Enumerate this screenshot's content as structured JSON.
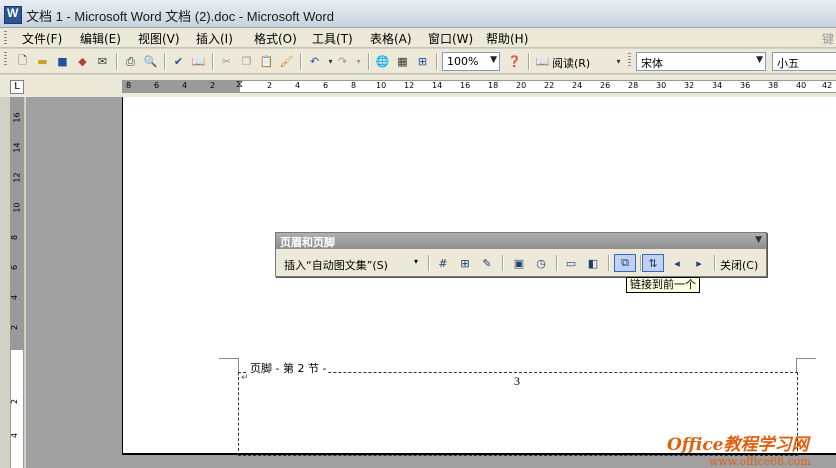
{
  "window": {
    "title": "文档 1 - Microsoft Word 文档 (2).doc - Microsoft Word"
  },
  "menu": {
    "items": [
      "文件(F)",
      "编辑(E)",
      "视图(V)",
      "插入(I)",
      "格式(O)",
      "工具(T)",
      "表格(A)",
      "窗口(W)",
      "帮助(H)"
    ],
    "right_cut": "键"
  },
  "toolbar": {
    "zoom": "100%",
    "read_label": "阅读(R)",
    "font_name": "宋体",
    "font_size": "小五",
    "icons": [
      "new-icon",
      "open-icon",
      "save-icon",
      "permission-icon",
      "email-icon",
      "print-icon",
      "print-preview-icon",
      "spelling-icon",
      "research-icon",
      "cut-icon",
      "copy-icon",
      "paste-icon",
      "format-painter-icon",
      "undo-icon",
      "redo-icon",
      "hyperlink-icon",
      "tables-borders-icon",
      "insert-table-icon",
      "help-icon",
      "read-icon"
    ]
  },
  "ruler": {
    "h_ticks": [
      "8",
      "6",
      "4",
      "2",
      "2",
      "4",
      "6",
      "8",
      "10",
      "12",
      "14",
      "16",
      "18",
      "20",
      "22",
      "24",
      "26",
      "28",
      "30",
      "32",
      "34",
      "36",
      "38",
      "40",
      "42"
    ],
    "v_ticks": [
      "16",
      "14",
      "12",
      "10",
      "8",
      "6",
      "4",
      "2",
      "2",
      "4"
    ],
    "tab_selector": "L"
  },
  "hf_toolbar": {
    "title": "页眉和页脚",
    "insert_autotext": "插入“自动图文集”(S)",
    "close_label": "关闭(C)",
    "icons": [
      "insert-page-number-icon",
      "insert-number-of-pages-icon",
      "format-page-number-icon",
      "insert-date-icon",
      "insert-time-icon",
      "page-setup-icon",
      "show-hide-text-icon",
      "link-to-previous-icon",
      "switch-header-footer-icon",
      "show-previous-icon",
      "show-next-icon"
    ]
  },
  "tooltip": "链接到前一个",
  "document": {
    "footer_label": "页脚 - 第 2 节 -",
    "page_number": "3"
  },
  "watermark": {
    "line1": "Office教程学习网",
    "line2": "www.office68.com"
  }
}
